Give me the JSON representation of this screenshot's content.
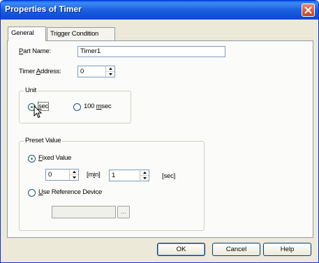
{
  "window": {
    "title": "Properties of Timer"
  },
  "tabs": [
    {
      "label": "General",
      "active": true
    },
    {
      "label": "Trigger Condition",
      "active": false
    }
  ],
  "part_name": {
    "label_prefix": "P",
    "label_rest": "art Name:",
    "value": "Timer1"
  },
  "timer_address": {
    "label_prefix": "Timer ",
    "label_accel": "A",
    "label_rest": "ddress:",
    "value": "0"
  },
  "unit": {
    "title": "Unit",
    "options": [
      {
        "accel": "s",
        "rest": "ec",
        "checked": true
      },
      {
        "prefix": "100 ",
        "accel": "m",
        "rest": "sec",
        "checked": false
      }
    ]
  },
  "preset": {
    "title": "Preset Value",
    "fixed_value": {
      "accel": "F",
      "rest": "ixed Value",
      "checked": true
    },
    "min_value": "0",
    "min_label_prefix": "[m",
    "min_label_accel": "i",
    "min_label_rest": "n]",
    "sec_value": "1",
    "sec_label": "[sec]",
    "use_reference": {
      "accel": "U",
      "rest": "se Reference Device",
      "checked": false
    },
    "browse_label": "..."
  },
  "buttons": {
    "ok": "OK",
    "cancel": "Cancel",
    "help": "Help"
  },
  "colors": {
    "titlebar": "#0c4fd6",
    "close": "#c8401c",
    "radio_dot": "#21a121"
  }
}
